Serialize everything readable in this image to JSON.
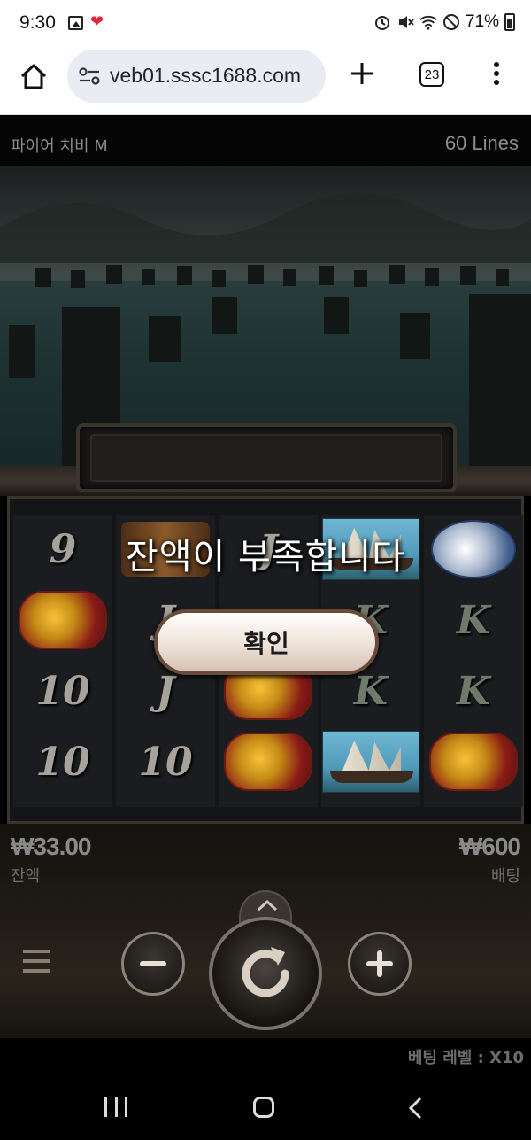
{
  "status_bar": {
    "time": "9:30",
    "battery": "71%",
    "icons": [
      "image-icon",
      "heart-icon",
      "alarm-icon",
      "mute-icon",
      "wifi-icon",
      "dnd-icon",
      "battery-icon"
    ]
  },
  "browser": {
    "url": "veb01.sssc1688.com",
    "tab_count": "23"
  },
  "game": {
    "title": "파이어 치비 M",
    "lines": "60 Lines"
  },
  "reels": [
    [
      "9",
      "lion",
      "10",
      "10"
    ],
    [
      "scroll",
      "J",
      "J",
      "10"
    ],
    [
      "J",
      "",
      "lion",
      "lion"
    ],
    [
      "ship",
      "K",
      "K",
      "ship"
    ],
    [
      "fan",
      "K",
      "K",
      "lion"
    ]
  ],
  "dialog": {
    "message": "잔액이 부족합니다",
    "confirm_label": "확인"
  },
  "panel": {
    "balance_value": "₩33.00",
    "balance_label": "잔액",
    "bet_value": "₩600",
    "bet_label": "배팅",
    "bet_level": "베팅 레벨 : X10"
  },
  "colors": {
    "button_border": "#6a4b3a",
    "panel_text": "#8a8a8a"
  }
}
